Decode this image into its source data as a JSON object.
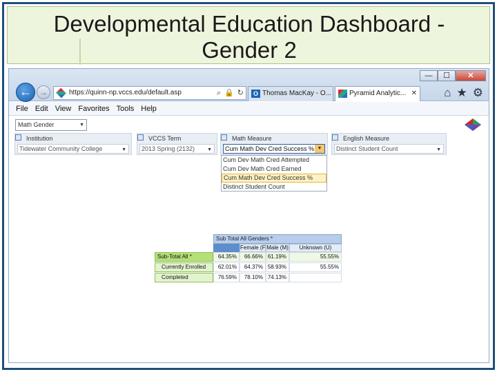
{
  "slide": {
    "title_line1": "Developmental Education Dashboard -",
    "title_line2": "Gender 2"
  },
  "browser": {
    "window_controls": {
      "minimize": "—",
      "maximize": "☐",
      "close": "✕"
    },
    "back_icon": "←",
    "forward_icon": "→",
    "address": "https://quinn-np.vccs.edu/default.asp",
    "tabs": [
      {
        "icon": "outlook-icon",
        "icon_text": "O",
        "label": "Thomas MacKay - O..."
      },
      {
        "icon": "pyramid-icon",
        "label": "Pyramid Analytic...",
        "close": "✕"
      }
    ],
    "toolbar_icons": {
      "home": "⌂",
      "favorites": "★",
      "settings": "⚙"
    },
    "menu": [
      "File",
      "Edit",
      "View",
      "Favorites",
      "Tools",
      "Help"
    ]
  },
  "report": {
    "selected_report": "Math Gender",
    "filters": [
      {
        "label": "Institution",
        "value": "Tidewater Community College"
      },
      {
        "label": "VCCS Term",
        "value": "2013 Spring (2132)"
      },
      {
        "label": "Math Measure",
        "value": "Cum Math Dev Cred Success %"
      },
      {
        "label": "English Measure",
        "value": "Distinct Student Count"
      }
    ],
    "math_measure_options": [
      "Cum Dev Math Cred Attempted",
      "Cum Dev Math Cred Earned",
      "Cum Math Dev Cred Success %",
      "Distinct Student Count"
    ],
    "highlighted_option_index": 2
  },
  "pivot": {
    "header": "Sub Total All Genders *",
    "columns": [
      "Female (F)",
      "Male (M)",
      "Unknown (U)"
    ],
    "rows": [
      {
        "label": "Sub-Total All *",
        "values": [
          "64.35%",
          "66.66%",
          "61.19%",
          "55.55%"
        ]
      },
      {
        "label": "Currently Enrolled",
        "values": [
          "62.01%",
          "64.37%",
          "58.93%",
          "55.55%"
        ]
      },
      {
        "label": "Completed",
        "values": [
          "76.59%",
          "78.10%",
          "74.13%",
          ""
        ]
      }
    ]
  },
  "colors": {
    "title_band": "#eef5dd",
    "slide_border": "#1f4e79",
    "pivot_row_green": "#b5df77",
    "pivot_header_blue": "#b7cde9"
  }
}
